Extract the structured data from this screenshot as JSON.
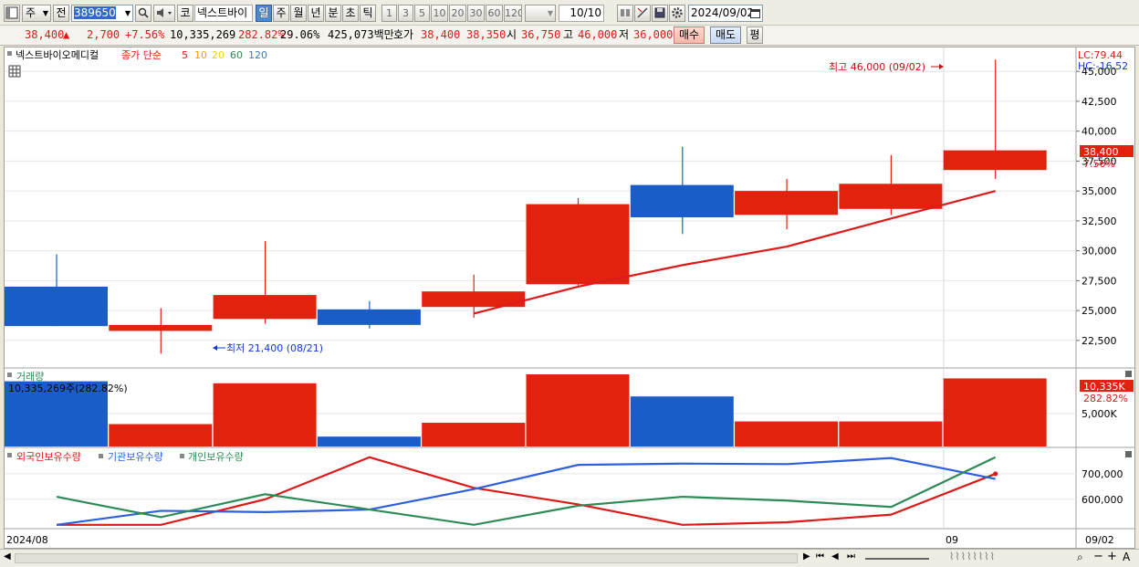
{
  "toolbar": {
    "type_label": "주",
    "prev_label": "전",
    "stock_code": "389650",
    "code_btn_label": "코",
    "stock_name": "넥스트바이",
    "period_buttons": [
      "일",
      "주",
      "월",
      "년",
      "분",
      "초",
      "틱"
    ],
    "interval_buttons": [
      "1",
      "3",
      "5",
      "10",
      "20",
      "30",
      "60",
      "120"
    ],
    "count_display": "10/10",
    "date_value": "2024/09/02"
  },
  "quote": {
    "price": "38,400",
    "up_icon": "▲",
    "change": "2,700",
    "change_pct": "+7.56%",
    "volume": "10,335,269",
    "volume_ratio": "282.82%",
    "turnover_pct": "29.06%",
    "amount": "425,073백만",
    "bid_label": "호가",
    "ask_price": "38,400",
    "bid_price": "38,350",
    "open_label": "시",
    "open": "36,750",
    "high_label": "고",
    "high": "46,000",
    "low_label": "저",
    "low": "36,000",
    "buy_label": "매수",
    "sell_label": "매도",
    "flat_label": "평"
  },
  "price_panel": {
    "stock_title": "넥스트바이오메디컬",
    "ma_label": "종가 단순",
    "ma_periods": [
      {
        "label": "5",
        "color": "#dd1a1a"
      },
      {
        "label": "10",
        "color": "#f0a000"
      },
      {
        "label": "20",
        "color": "#e8d400"
      },
      {
        "label": "60",
        "color": "#2e8b57"
      },
      {
        "label": "120",
        "color": "#3a7fc1"
      }
    ],
    "lc_text": "LC:79.44",
    "hc_text": "HC:-16.52",
    "max_annotation": "최고 46,000 (09/02)",
    "min_annotation": "최저 21,400 (08/21)",
    "last_price_tag": "38,400",
    "last_pct_tag": "7.56%"
  },
  "volume_panel": {
    "title": "거래량",
    "info": "10,335,269주(282.82%)",
    "last_tag": "10,335K",
    "last_pct": "282.82%"
  },
  "holdings_panel": {
    "legend": [
      {
        "label": "외국인보유수량",
        "color": "#dd1a1a"
      },
      {
        "label": "기관보유수량",
        "color": "#2f5fdc"
      },
      {
        "label": "개인보유수량",
        "color": "#2e8b57"
      }
    ]
  },
  "x_axis": {
    "start": "2024/08",
    "month_label": "09",
    "end": "09/02"
  },
  "colors": {
    "up": "#e2210f",
    "down": "#1a5cc8",
    "ma5": "#dd1a1a",
    "grid": "#e6e6e6"
  },
  "chart_data": [
    {
      "type": "candlestick",
      "title": "넥스트바이오메디컬",
      "y_ticks": [
        "45,000",
        "42,500",
        "40,000",
        "37,500",
        "35,000",
        "32,500",
        "30,000",
        "27,500",
        "25,000",
        "22,500"
      ],
      "ylim": [
        20200,
        47000
      ],
      "candles": [
        {
          "open": 27000,
          "high": 29700,
          "low": 23700,
          "close": 23700
        },
        {
          "open": 23300,
          "high": 25200,
          "low": 21400,
          "close": 23800
        },
        {
          "open": 24300,
          "high": 30800,
          "low": 23900,
          "close": 26300
        },
        {
          "open": 25100,
          "high": 25800,
          "low": 23500,
          "close": 23800
        },
        {
          "open": 25300,
          "high": 28000,
          "low": 24400,
          "close": 26600
        },
        {
          "open": 27200,
          "high": 34400,
          "low": 27100,
          "close": 33900
        },
        {
          "open": 35500,
          "high": 38700,
          "low": 31400,
          "close": 32800
        },
        {
          "open": 33000,
          "high": 36000,
          "low": 31800,
          "close": 35000
        },
        {
          "open": 33500,
          "high": 38000,
          "low": 33000,
          "close": 35600
        },
        {
          "open": 36750,
          "high": 46000,
          "low": 36000,
          "close": 38400
        }
      ],
      "ma5": [
        null,
        null,
        null,
        null,
        24750,
        27000,
        28800,
        30350,
        32700,
        35000
      ]
    },
    {
      "type": "bar",
      "title": "거래량",
      "y_ticks": [
        "5,000K"
      ],
      "ylim": [
        0,
        10400000
      ],
      "values": [
        9900000,
        3400000,
        9600000,
        1500000,
        3600000,
        11000000,
        7600000,
        3800000,
        3800000,
        10335269
      ],
      "directions": [
        "down",
        "up",
        "up",
        "down",
        "up",
        "up",
        "down",
        "up",
        "up",
        "up"
      ]
    },
    {
      "type": "line",
      "title": "보유수량",
      "y_ticks": [
        "700,000",
        "600,000"
      ],
      "ylim": [
        485000,
        800000
      ],
      "series": [
        {
          "name": "외국인보유수량",
          "values": [
            500000,
            500000,
            600000,
            765000,
            645000,
            580000,
            500000,
            510000,
            540000,
            700000
          ]
        },
        {
          "name": "기관보유수량",
          "values": [
            500000,
            555000,
            550000,
            560000,
            640000,
            735000,
            740000,
            738000,
            762000,
            680000
          ]
        },
        {
          "name": "개인보유수량",
          "values": [
            610000,
            530000,
            620000,
            560000,
            500000,
            575000,
            610000,
            595000,
            570000,
            765000
          ]
        }
      ]
    }
  ]
}
